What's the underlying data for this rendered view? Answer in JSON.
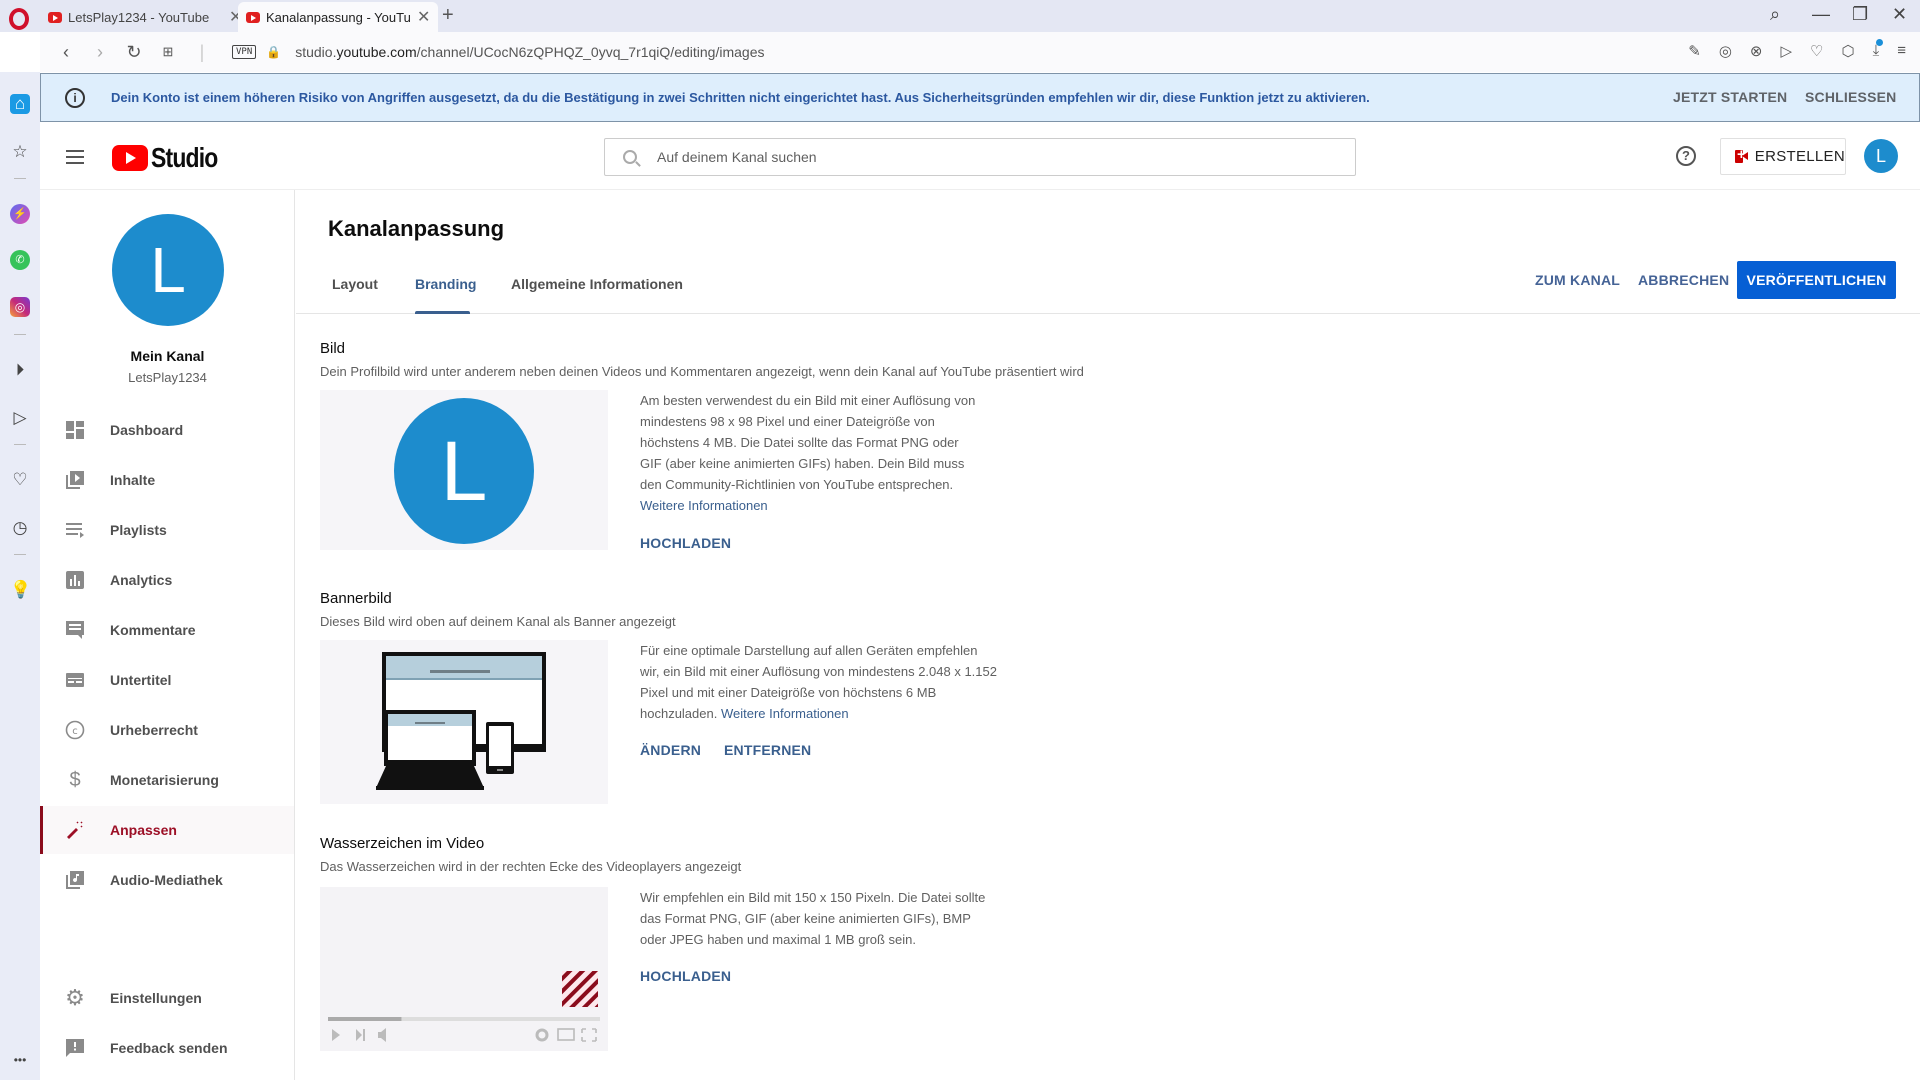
{
  "browser": {
    "tabs": [
      {
        "title": "LetsPlay1234 - YouTube",
        "active": false
      },
      {
        "title": "Kanalanpassung - YouTube",
        "active": true
      }
    ],
    "new_tab": "+",
    "url_prefix": "studio.",
    "url_domain": "youtube.com",
    "url_path": "/channel/UCocN6zQPHQZ_0yvq_7r1qiQ/editing/images",
    "vpn_label": "VPN",
    "window_controls": {
      "search": "⌕",
      "minimize": "—",
      "restore": "❐",
      "close": "✕"
    },
    "toolbar_icons": [
      "✎",
      "◎",
      "⊗",
      "▷",
      "♡",
      "⬡",
      "⤓",
      "≡"
    ]
  },
  "opera_sidebar": {
    "icons": [
      "home",
      "star",
      "messenger",
      "whatsapp",
      "instagram",
      "player",
      "send",
      "heart",
      "history",
      "tips"
    ],
    "more": "•••"
  },
  "alert": {
    "text": "Dein Konto ist einem höheren Risiko von Angriffen ausgesetzt, da du die Bestätigung in zwei Schritten nicht eingerichtet hast. Aus Sicherheitsgründen empfehlen wir dir, diese Funktion jetzt zu aktivieren.",
    "start_label": "JETZT STARTEN",
    "close_label": "SCHLIESSEN"
  },
  "header": {
    "logo_text": "Studio",
    "search_placeholder": "Auf deinem Kanal suchen",
    "help": "?",
    "create_label": "ERSTELLEN",
    "avatar_letter": "L"
  },
  "channel": {
    "avatar_letter": "L",
    "name": "Mein Kanal",
    "handle": "LetsPlay1234"
  },
  "nav": {
    "items": [
      {
        "label": "Dashboard",
        "icon": "dashboard"
      },
      {
        "label": "Inhalte",
        "icon": "content"
      },
      {
        "label": "Playlists",
        "icon": "playlists"
      },
      {
        "label": "Analytics",
        "icon": "analytics"
      },
      {
        "label": "Kommentare",
        "icon": "comments"
      },
      {
        "label": "Untertitel",
        "icon": "subtitles"
      },
      {
        "label": "Urheberrecht",
        "icon": "copyright"
      },
      {
        "label": "Monetarisierung",
        "icon": "dollar"
      },
      {
        "label": "Anpassen",
        "icon": "magic-wand",
        "active": true
      },
      {
        "label": "Audio-Mediathek",
        "icon": "audio-library"
      }
    ],
    "bottom": [
      {
        "label": "Einstellungen",
        "icon": "gear"
      },
      {
        "label": "Feedback senden",
        "icon": "feedback"
      }
    ]
  },
  "main": {
    "title": "Kanalanpassung",
    "tabs": [
      {
        "label": "Layout"
      },
      {
        "label": "Branding",
        "active": true
      },
      {
        "label": "Allgemeine Informationen"
      }
    ],
    "actions": {
      "to_channel": "ZUM KANAL",
      "cancel": "ABBRECHEN",
      "publish": "VERÖFFENTLICHEN"
    },
    "sections": {
      "picture": {
        "title": "Bild",
        "desc": "Dein Profilbild wird unter anderem neben deinen Videos und Kommentaren angezeigt, wenn dein Kanal auf YouTube präsentiert wird",
        "avatar_letter": "L",
        "body": "Am besten verwendest du ein Bild mit einer Auflösung von mindestens 98 x 98 Pixel und einer Dateigröße von höchstens 4 MB. Die Datei sollte das Format PNG oder GIF (aber keine animierten GIFs) haben. Dein Bild muss den Community-Richtlinien von YouTube entsprechen.",
        "link": "Weitere Informationen",
        "upload": "HOCHLADEN"
      },
      "banner": {
        "title": "Bannerbild",
        "desc": "Dieses Bild wird oben auf deinem Kanal als Banner angezeigt",
        "body": "Für eine optimale Darstellung auf allen Geräten empfehlen wir, ein Bild mit einer Auflösung von mindestens 2.048 x 1.152 Pixel und mit einer Dateigröße von höchstens 6 MB hochzuladen.",
        "link": "Weitere Informationen",
        "change": "ÄNDERN",
        "remove": "ENTFERNEN"
      },
      "watermark": {
        "title": "Wasserzeichen im Video",
        "desc": "Das Wasserzeichen wird in der rechten Ecke des Videoplayers angezeigt",
        "body": "Wir empfehlen ein Bild mit 150 x 150 Pixeln. Die Datei sollte das Format PNG, GIF (aber keine animierten GIFs), BMP oder JPEG haben und maximal 1 MB groß sein.",
        "upload": "HOCHLADEN",
        "player_progress": 0.27
      }
    }
  },
  "colors": {
    "accent_blue": "#065fd4",
    "link_blue": "#3a5f8e",
    "active_red": "#9c0f26",
    "avatar_blue": "#1d8ccd",
    "banner_bg": "#deeefc"
  }
}
